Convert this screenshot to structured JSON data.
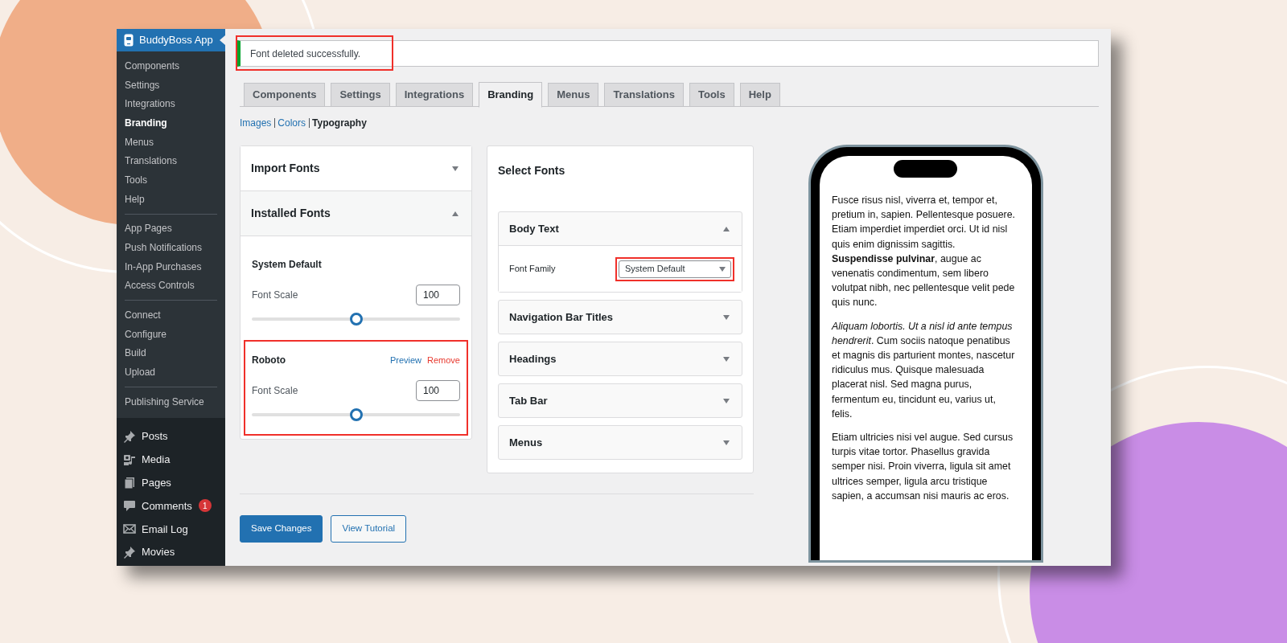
{
  "sidebar": {
    "plugin_title": "BuddyBoss App",
    "groups": [
      [
        {
          "label": "Components",
          "selected": false
        },
        {
          "label": "Settings",
          "selected": false
        },
        {
          "label": "Integrations",
          "selected": false
        },
        {
          "label": "Branding",
          "selected": true
        },
        {
          "label": "Menus",
          "selected": false
        },
        {
          "label": "Translations",
          "selected": false
        },
        {
          "label": "Tools",
          "selected": false
        },
        {
          "label": "Help",
          "selected": false
        }
      ],
      [
        {
          "label": "App Pages",
          "selected": false
        },
        {
          "label": "Push Notifications",
          "selected": false
        },
        {
          "label": "In-App Purchases",
          "selected": false
        },
        {
          "label": "Access Controls",
          "selected": false
        }
      ],
      [
        {
          "label": "Connect",
          "selected": false
        },
        {
          "label": "Configure",
          "selected": false
        },
        {
          "label": "Build",
          "selected": false
        },
        {
          "label": "Upload",
          "selected": false
        }
      ],
      [
        {
          "label": "Publishing Service",
          "selected": false
        }
      ]
    ],
    "menu": [
      {
        "label": "Posts",
        "kind": "pin"
      },
      {
        "label": "Media",
        "kind": "media"
      },
      {
        "label": "Pages",
        "kind": "pages"
      },
      {
        "label": "Comments",
        "kind": "comment",
        "badge": "1"
      },
      {
        "label": "Email Log",
        "kind": "mail"
      },
      {
        "label": "Movies",
        "kind": "pin"
      }
    ]
  },
  "notice": {
    "text": "Font deleted successfully.",
    "highlighted": true
  },
  "tabs": [
    {
      "label": "Components",
      "selected": false
    },
    {
      "label": "Settings",
      "selected": false
    },
    {
      "label": "Integrations",
      "selected": false
    },
    {
      "label": "Branding",
      "selected": true
    },
    {
      "label": "Menus",
      "selected": false
    },
    {
      "label": "Translations",
      "selected": false
    },
    {
      "label": "Tools",
      "selected": false
    },
    {
      "label": "Help",
      "selected": false
    }
  ],
  "subnav": [
    {
      "label": "Images",
      "selected": false
    },
    {
      "label": "Colors",
      "selected": false
    },
    {
      "label": "Typography",
      "selected": true
    }
  ],
  "fonts_panel": {
    "sections": [
      {
        "title": "Import Fonts",
        "expanded": false
      },
      {
        "title": "Installed Fonts",
        "expanded": true
      }
    ],
    "installed": [
      {
        "name": "System Default",
        "scale_label": "Font Scale",
        "scale_value": "100",
        "level": 0.5,
        "highlighted": false
      },
      {
        "name": "Roboto",
        "scale_label": "Font Scale",
        "scale_value": "100",
        "level": 0.5,
        "highlighted": true,
        "actions": [
          {
            "label": "Preview",
            "kind": "preview"
          },
          {
            "label": "Remove",
            "kind": "remove"
          }
        ]
      }
    ]
  },
  "select_fonts": {
    "title": "Select Fonts",
    "sections": [
      {
        "title": "Body Text",
        "expanded": true,
        "field_label": "Font Family",
        "value": "System Default",
        "highlighted": true
      },
      {
        "title": "Navigation Bar Titles",
        "expanded": false
      },
      {
        "title": "Headings",
        "expanded": false
      },
      {
        "title": "Tab Bar",
        "expanded": false
      },
      {
        "title": "Menus",
        "expanded": false
      }
    ]
  },
  "buttons": [
    {
      "label": "Save Changes",
      "kind": "primary"
    },
    {
      "label": "View Tutorial",
      "kind": "secondary"
    }
  ],
  "preview": {
    "paragraphs": [
      "Fusce risus nisl, viverra et, tempor et, pretium in, sapien. Pellentesque posuere. Etiam imperdiet imperdiet orci. Ut id nisl quis enim dignissim sagittis. **Suspendisse pulvinar**, augue ac venenatis condimentum, sem libero volutpat nibh, nec pellentesque velit pede quis nunc.",
      "*Aliquam lobortis. Ut a nisl id ante tempus hendrerit*. Cum sociis natoque penatibus et magnis dis parturient montes, nascetur ridiculus mus. Quisque malesuada placerat nisl. Sed magna purus, fermentum eu, tincidunt eu, varius ut, felis.",
      "Etiam ultricies nisi vel augue. Sed cursus turpis vitae tortor. Phasellus gravida semper nisi. Proin viverra, ligula sit amet ultrices semper, ligula arcu tristique sapien, a accumsan nisi mauris ac eros."
    ]
  }
}
